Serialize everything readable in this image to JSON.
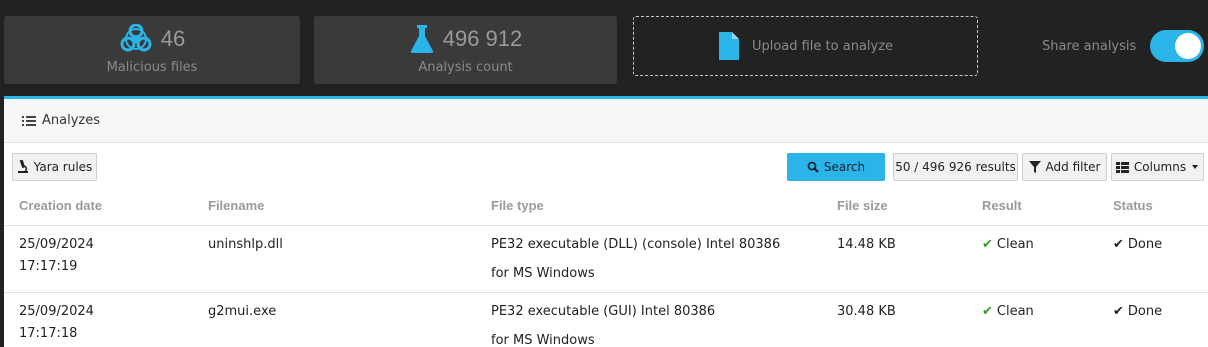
{
  "stats": {
    "malicious": {
      "value": "46",
      "label": "Malicious files",
      "icon": "biohazard-icon"
    },
    "analysis": {
      "value": "496 912",
      "label": "Analysis count",
      "icon": "flask-icon"
    }
  },
  "upload": {
    "label": "Upload file to analyze",
    "icon": "file-icon"
  },
  "share": {
    "label": "Share analysis",
    "enabled": true
  },
  "panel": {
    "title": "Analyzes",
    "yara_label": "Yara rules",
    "search_label": "Search",
    "results_label": "50 / 496 926 results",
    "filter_label": "Add filter",
    "columns_label": "Columns"
  },
  "table": {
    "headers": [
      "Creation date",
      "Filename",
      "File type",
      "File size",
      "Result",
      "Status"
    ],
    "rows": [
      {
        "date": "25/09/2024",
        "time": "17:17:19",
        "filename": "uninshlp.dll",
        "type1": "PE32 executable (DLL) (console) Intel 80386",
        "type2": "for MS Windows",
        "size": "14.48 KB",
        "result": "Clean",
        "status": "Done"
      },
      {
        "date": "25/09/2024",
        "time": "17:17:18",
        "filename": "g2mui.exe",
        "type1": "PE32 executable (GUI) Intel 80386",
        "type2": "for MS Windows",
        "size": "30.48 KB",
        "result": "Clean",
        "status": "Done"
      }
    ]
  },
  "colors": {
    "accent": "#2ab4e8",
    "background": "#222222",
    "card": "#3a3a3a",
    "clean": "#2e9e2e"
  }
}
